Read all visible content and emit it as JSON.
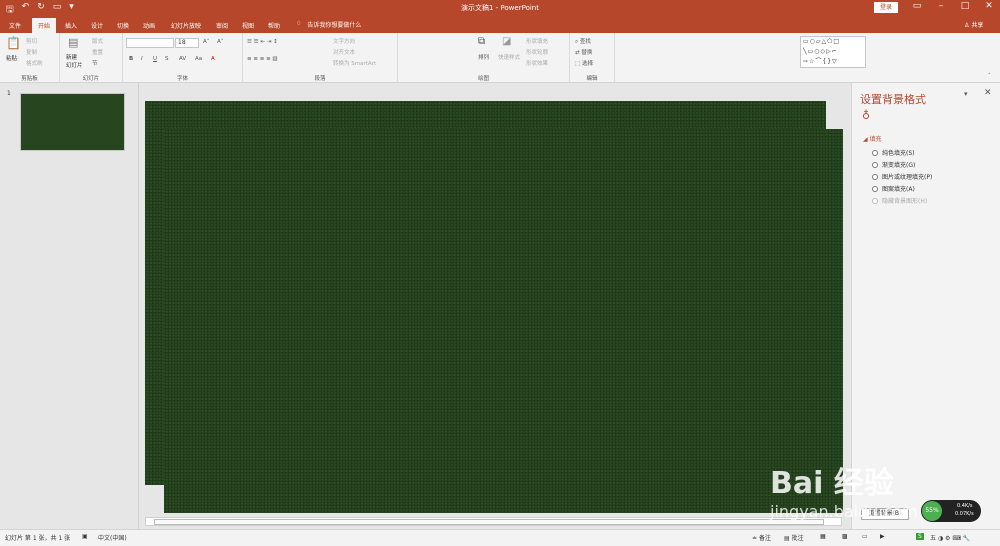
{
  "app": {
    "title": "演示文稿1 - PowerPoint",
    "login": "登录",
    "share": "共享"
  },
  "tabs": [
    "文件",
    "开始",
    "插入",
    "设计",
    "切换",
    "动画",
    "幻灯片放映",
    "审阅",
    "视图",
    "帮助"
  ],
  "tellme": "告诉我你想要做什么",
  "ribbon": {
    "clipboard": {
      "paste": "粘贴",
      "cut": "剪切",
      "copy": "复制",
      "format_painter": "格式刷",
      "label": "剪贴板"
    },
    "slides": {
      "new_slide": "新建\n幻灯片",
      "layout": "版式",
      "reset": "重置",
      "section": "节",
      "label": "幻灯片"
    },
    "font": {
      "font_name": "",
      "font_size": "18",
      "bold": "B",
      "italic": "I",
      "underline": "U",
      "strike": "S",
      "label": "字体"
    },
    "paragraph": {
      "text_dir": "文字方向",
      "align_text": "对齐文本",
      "smartart": "转换为 SmartArt",
      "label": "段落"
    },
    "drawing": {
      "arrange": "排列",
      "quick_styles": "快速样式",
      "fill": "形状填充",
      "outline": "形状轮廓",
      "effects": "形状效果",
      "label": "绘图"
    },
    "editing": {
      "find": "查找",
      "replace": "替换",
      "select": "选择",
      "label": "编辑"
    }
  },
  "slide_panel": {
    "number": "1"
  },
  "format_pane": {
    "title": "设置背景格式",
    "section": "填充",
    "options": [
      "纯色填充(S)",
      "渐变填充(G)",
      "图片或纹理填充(P)",
      "图案填充(A)",
      "隐藏背景图形(H)"
    ],
    "reset_button": "重置背景(B)"
  },
  "status": {
    "slide_info": "幻灯片 第 1 张，共 1 张",
    "language": "中文(中国)",
    "notes": "备注",
    "comments": "批注"
  },
  "network": {
    "up": "0.4K/s",
    "down": "0.07K/s",
    "pct": "55%"
  },
  "watermark": {
    "brand": "Bai 经验",
    "url": "jingyan.baidu.com"
  },
  "colors": {
    "accent": "#b7472a",
    "slide_bg": "#27461f"
  }
}
